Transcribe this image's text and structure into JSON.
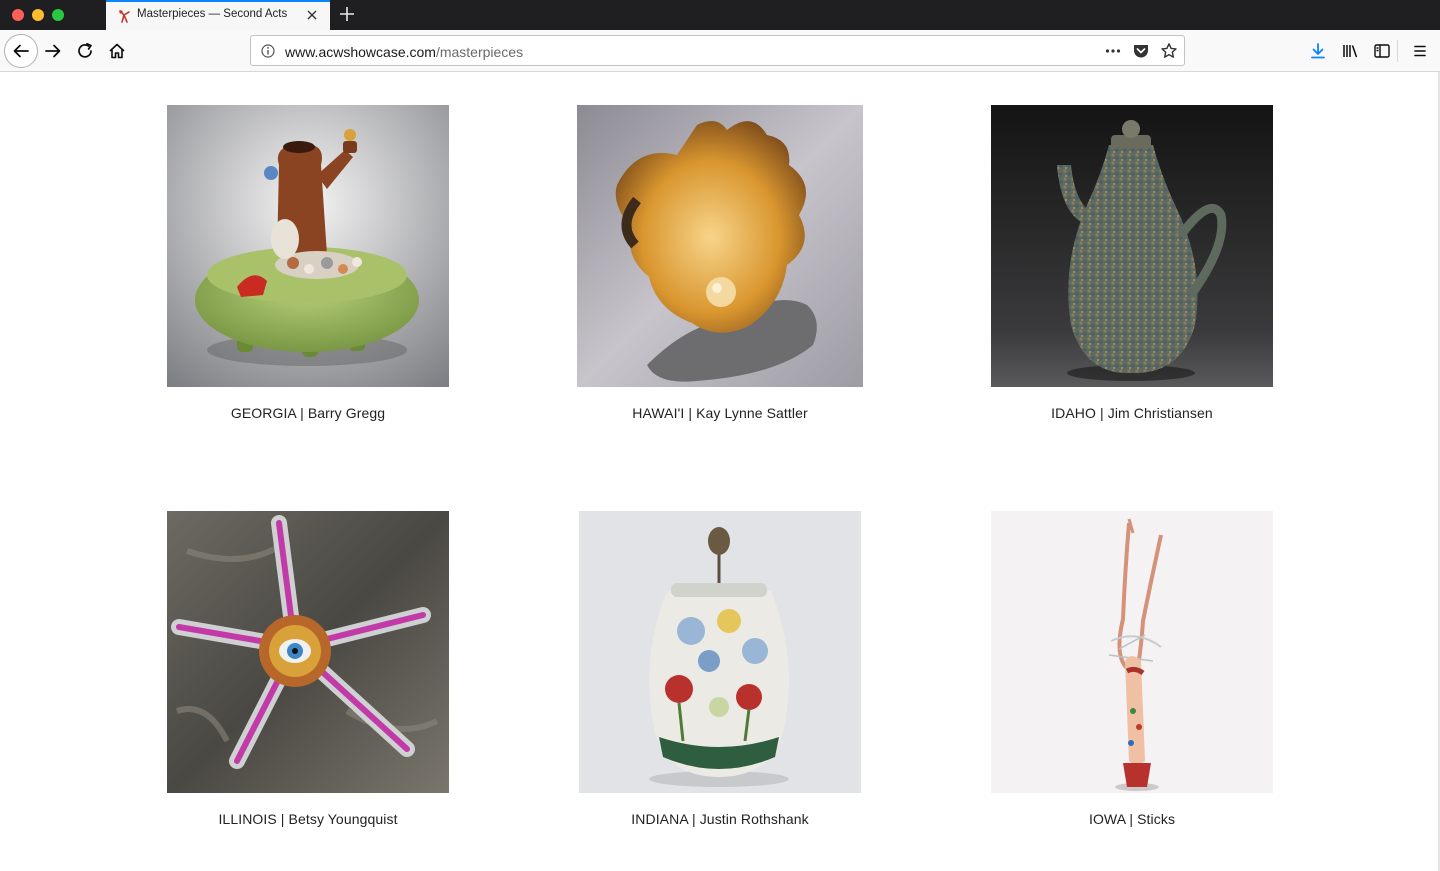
{
  "browser": {
    "tab": {
      "title": "Masterpieces — Second Acts"
    },
    "url": {
      "domain": "www.acwshowcase.com",
      "path": "/masterpieces"
    }
  },
  "gallery": {
    "items": [
      {
        "caption": "GEORGIA | Barry Gregg"
      },
      {
        "caption": "HAWAI'I | Kay Lynne Sattler"
      },
      {
        "caption": "IDAHO | Jim Christiansen"
      },
      {
        "caption": "ILLINOIS | Betsy Youngquist"
      },
      {
        "caption": "INDIANA | Justin Rothshank"
      },
      {
        "caption": "IOWA | Sticks"
      }
    ]
  },
  "colors": {
    "accent": "#0a84ff",
    "tab_strip": "#1f1f21",
    "toolbar": "#f9f9fa"
  }
}
